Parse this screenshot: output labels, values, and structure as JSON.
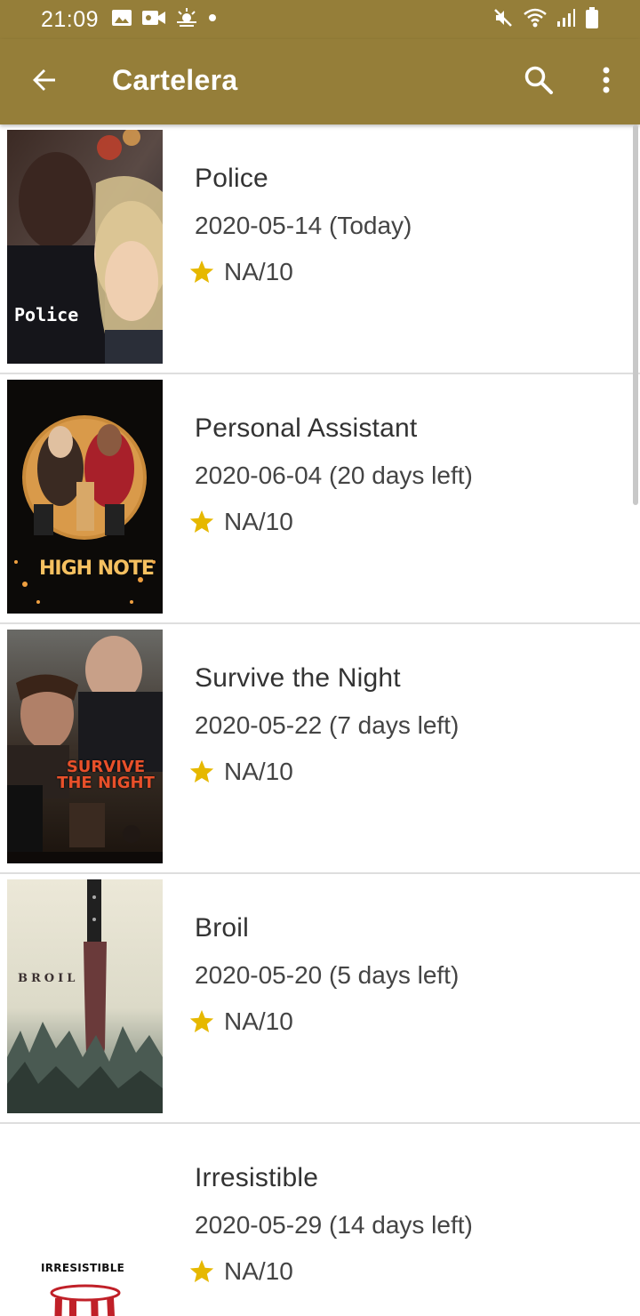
{
  "status_bar": {
    "time": "21:09",
    "icons": [
      "image-icon",
      "video-icon",
      "weather-icon",
      "dot-icon",
      "mute-icon",
      "wifi-icon",
      "signal-icon",
      "battery-icon"
    ]
  },
  "toolbar": {
    "title": "Cartelera",
    "back_icon": "arrow-back-icon",
    "search_icon": "search-icon",
    "more_icon": "more-vert-icon"
  },
  "colors": {
    "primary": "#957e39",
    "star": "#e6b800",
    "divider": "#dedede"
  },
  "movies": [
    {
      "title": "Police",
      "date": "2020-05-14 (Today)",
      "rating": "NA/10",
      "poster_text": "Police"
    },
    {
      "title": "Personal Assistant",
      "date": "2020-06-04 (20 days left)",
      "rating": "NA/10",
      "poster_text": "HIGH NOTE"
    },
    {
      "title": "Survive the Night",
      "date": "2020-05-22 (7 days left)",
      "rating": "NA/10",
      "poster_text": "SURVIVE THE NIGHT"
    },
    {
      "title": "Broil",
      "date": "2020-05-20 (5 days left)",
      "rating": "NA/10",
      "poster_text": "BROIL"
    },
    {
      "title": "Irresistible",
      "date": "2020-05-29 (14 days left)",
      "rating": "NA/10",
      "poster_text": "IRRESISTIBLE"
    }
  ]
}
